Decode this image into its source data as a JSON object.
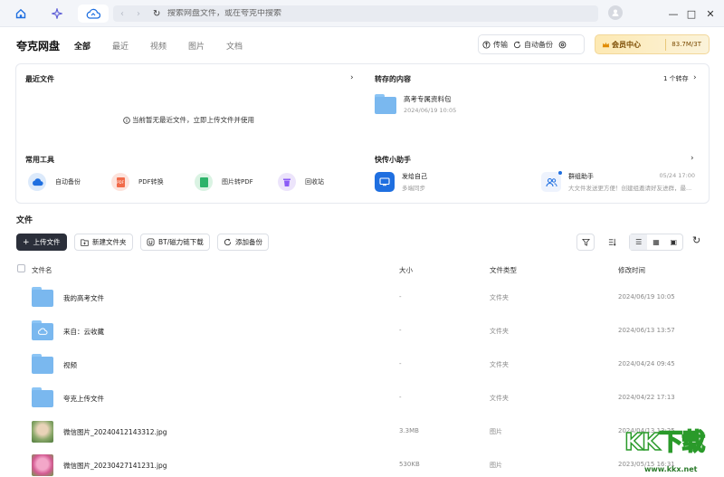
{
  "titlebar": {
    "search_placeholder": "搜索网盘文件，或在夸克中搜索",
    "win_controls": [
      "minimize-icon",
      "maximize-icon",
      "close-icon"
    ]
  },
  "header": {
    "brand": "夸克网盘",
    "tabs": [
      "全部",
      "最近",
      "视频",
      "图片",
      "文档"
    ],
    "active_tab": "全部",
    "transfer_label": "传输",
    "backup_label": "自动备份",
    "vip_label": "会员中心",
    "quota": "83.7M/3T"
  },
  "panel": {
    "recent": {
      "title": "最近文件",
      "empty_message": "当前暂无最近文件，立即上传文件并使用"
    },
    "saved": {
      "title": "转存的内容",
      "count": "1 个转存",
      "item_name": "高考专属资料包",
      "item_time": "2024/06/19 10:05"
    },
    "tools": {
      "title": "常用工具",
      "items": [
        {
          "label": "自动备份",
          "icon": "cloud-backup-icon"
        },
        {
          "label": "PDF转换",
          "icon": "pdf-icon"
        },
        {
          "label": "图片转PDF",
          "icon": "image-to-pdf-icon"
        },
        {
          "label": "回收站",
          "icon": "recycle-bin-icon"
        }
      ]
    },
    "helper": {
      "title": "快传小助手",
      "items": [
        {
          "name": "发给自己",
          "sub": "多端同步",
          "time": ""
        },
        {
          "name": "群组助手",
          "sub": "大文件发送更方便！创建组邀请好友进群，最...",
          "time": "05/24 17:00"
        }
      ]
    }
  },
  "files": {
    "title": "文件",
    "buttons": {
      "upload": "上传文件",
      "new_folder": "新建文件夹",
      "bt": "BT/磁力链下载",
      "add_backup": "添加备份"
    },
    "columns": [
      "文件名",
      "大小",
      "文件类型",
      "修改时间"
    ],
    "rows": [
      {
        "name": "我的高考文件",
        "size": "-",
        "type": "文件夹",
        "time": "2024/06/19 10:05",
        "kind": "folder"
      },
      {
        "name": "来自：云收藏",
        "size": "-",
        "type": "文件夹",
        "time": "2024/06/13 13:57",
        "kind": "folder-cloud"
      },
      {
        "name": "视频",
        "size": "-",
        "type": "文件夹",
        "time": "2024/04/24 09:45",
        "kind": "folder"
      },
      {
        "name": "夸克上传文件",
        "size": "-",
        "type": "文件夹",
        "time": "2024/04/22 17:13",
        "kind": "folder"
      },
      {
        "name": "微信图片_20240412143312.jpg",
        "size": "3.3MB",
        "type": "图片",
        "time": "2024/04/13 13:25",
        "kind": "photo-a"
      },
      {
        "name": "微信图片_20230427141231.jpg",
        "size": "530KB",
        "type": "图片",
        "time": "2023/05/15 16:31",
        "kind": "photo-b"
      }
    ]
  },
  "watermark": {
    "text": "KK下载",
    "url": "www.kkx.net"
  },
  "colors": {
    "accent": "#1f6fe0",
    "folder": "#7ab8ef",
    "dark_button": "#2b2f3a",
    "vip_gold": "#fde9b3"
  }
}
